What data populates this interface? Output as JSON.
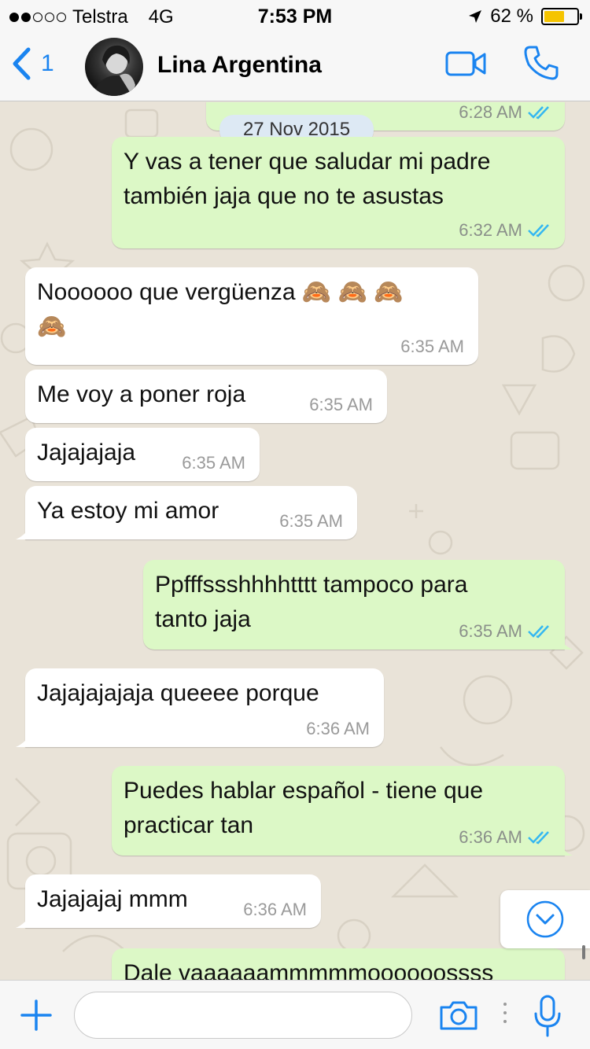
{
  "status_bar": {
    "carrier": "Telstra",
    "network": "4G",
    "time": "7:53 PM",
    "battery": "62 %",
    "battery_level": 0.62,
    "signal_bars_filled": 2,
    "signal_bars_total": 5
  },
  "header": {
    "back_count": "1",
    "contact_name": "Lina Argentina",
    "icons": [
      "back-chevron-icon",
      "video-call-icon",
      "phone-call-icon"
    ]
  },
  "chat": {
    "date_chip": "27 Nov 2015",
    "messages": [
      {
        "direction": "out",
        "text": "",
        "time": "6:28 AM",
        "read": true
      },
      {
        "direction": "out",
        "text": "Y vas a tener que saludar mi padre\ntambién jaja que no te asustas",
        "time": "6:32 AM",
        "read": true
      },
      {
        "direction": "in",
        "text": "Noooooo que vergüenza 🙈 🙈 🙈\n🙈",
        "time": "6:35 AM"
      },
      {
        "direction": "in",
        "text": "Me voy a poner roja",
        "time": "6:35 AM"
      },
      {
        "direction": "in",
        "text": "Jajajajaja",
        "time": "6:35 AM"
      },
      {
        "direction": "in",
        "text": "Ya estoy mi amor",
        "time": "6:35 AM"
      },
      {
        "direction": "out",
        "text": "Ppfffssshhhhtttt tampoco para\ntanto jaja",
        "time": "6:35 AM",
        "read": true
      },
      {
        "direction": "in",
        "text": "Jajajajajaja queeee porque",
        "time": "6:36 AM"
      },
      {
        "direction": "out",
        "text": "Puedes hablar español - tiene que\npracticar tan",
        "time": "6:36 AM",
        "read": true
      },
      {
        "direction": "in",
        "text": "Jajajajaj mmm",
        "time": "6:36 AM"
      },
      {
        "direction": "out",
        "text": "Dale vaaaaaammmmmoooooossss",
        "time": "",
        "read": true
      }
    ]
  },
  "input_bar": {
    "placeholder": "",
    "icons": [
      "plus-icon",
      "camera-icon",
      "microphone-icon"
    ]
  },
  "colors": {
    "accent": "#1a84f0",
    "outgoing_bubble": "#dcf8c6",
    "incoming_bubble": "#ffffff",
    "read_ticks": "#34b7f1",
    "wallpaper": "#e9e3d8"
  }
}
